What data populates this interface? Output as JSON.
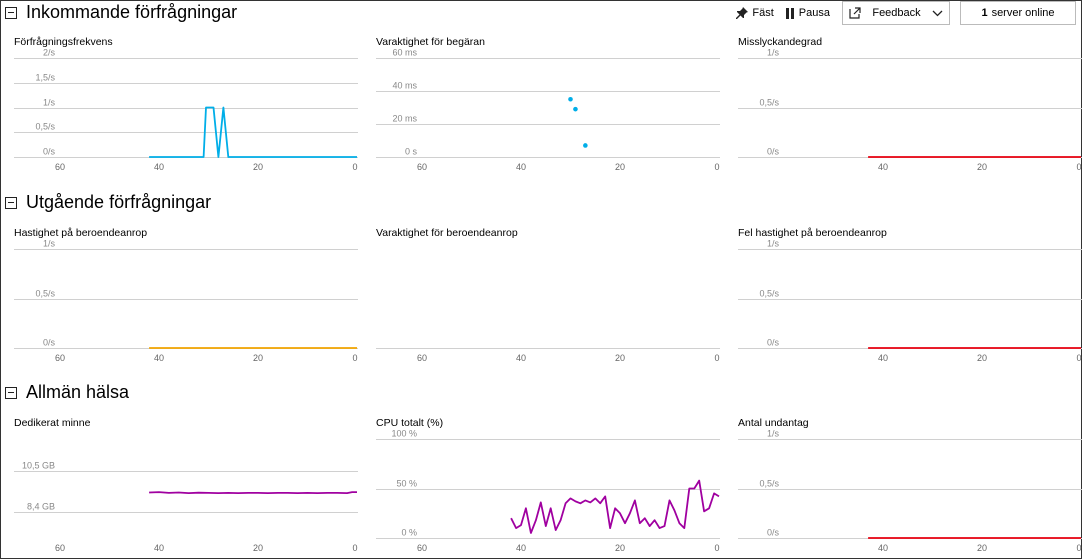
{
  "toolbar": {
    "pin_label": "Fäst",
    "pause_label": "Pausa",
    "feedback_label": "Feedback",
    "server_count": "1",
    "server_label": "server online"
  },
  "sections": [
    {
      "title": "Inkommande förfrågningar"
    },
    {
      "title": "Utgående förfrågningar"
    },
    {
      "title": "Allmän hälsa"
    }
  ],
  "colors": {
    "requests": "#00aee8",
    "failed": "#e8000f",
    "dependency": "#f2a500",
    "health": "#a000a0",
    "grid": "#d0d0d0"
  },
  "chart_data": [
    {
      "type": "line",
      "title": "Förfrågningsfrekvens",
      "yticks": [
        "2/s",
        "1,5/s",
        "1/s",
        "0,5/s",
        "0/s"
      ],
      "ylim": [
        0,
        2
      ],
      "xticks": [
        "60",
        "40",
        "20",
        "0"
      ],
      "xlim": [
        60,
        0
      ],
      "color": "#00aee8",
      "series": [
        {
          "x": [
            42,
            31,
            30.5,
            29,
            28,
            27,
            26,
            0
          ],
          "y": [
            0,
            0,
            1,
            1,
            0,
            1,
            0,
            0
          ]
        }
      ]
    },
    {
      "type": "scatter",
      "title": "Varaktighet för begäran",
      "yticks": [
        "60 ms",
        "40 ms",
        "20 ms",
        "0 s"
      ],
      "ylim": [
        0,
        60
      ],
      "xticks": [
        "60",
        "40",
        "20",
        "0"
      ],
      "xlim": [
        60,
        0
      ],
      "color": "#00aee8",
      "series": [
        {
          "x": [
            30,
            29,
            27
          ],
          "y": [
            35,
            29,
            7
          ]
        }
      ]
    },
    {
      "type": "line",
      "title": "Misslyckandegrad",
      "yticks": [
        "1/s",
        "0,5/s",
        "0/s"
      ],
      "ylim": [
        0,
        1
      ],
      "xticks": [
        "40",
        "20",
        "0"
      ],
      "xlim": [
        60,
        0
      ],
      "color": "#e8000f",
      "series": [
        {
          "x": [
            43,
            0
          ],
          "y": [
            0,
            0
          ]
        }
      ]
    },
    {
      "type": "line",
      "title": "Hastighet på beroendeanrop",
      "yticks": [
        "1/s",
        "0,5/s",
        "0/s"
      ],
      "ylim": [
        0,
        1
      ],
      "xticks": [
        "60",
        "40",
        "20",
        "0"
      ],
      "xlim": [
        60,
        0
      ],
      "color": "#f2a500",
      "series": [
        {
          "x": [
            42,
            0
          ],
          "y": [
            0,
            0
          ]
        }
      ]
    },
    {
      "type": "line",
      "title": "Varaktighet för beroendeanrop",
      "yticks": [],
      "ylim": [
        0,
        1
      ],
      "xticks": [
        "60",
        "40",
        "20",
        "0"
      ],
      "xlim": [
        60,
        0
      ],
      "color": "#00aee8",
      "series": []
    },
    {
      "type": "line",
      "title": "Fel hastighet på beroendeanrop",
      "yticks": [
        "1/s",
        "0,5/s",
        "0/s"
      ],
      "ylim": [
        0,
        1
      ],
      "xticks": [
        "40",
        "20",
        "0"
      ],
      "xlim": [
        60,
        0
      ],
      "color": "#e8000f",
      "series": [
        {
          "x": [
            43,
            0
          ],
          "y": [
            0,
            0
          ]
        }
      ]
    },
    {
      "type": "line",
      "title": "Dedikerat minne",
      "yticks": [
        "10,5 GB",
        "8,4 GB"
      ],
      "ytickvals": [
        10.5,
        8.4
      ],
      "ylim": [
        7.1,
        12.1
      ],
      "xticks": [
        "60",
        "40",
        "20",
        "0"
      ],
      "xlim": [
        60,
        0
      ],
      "color": "#a000a0",
      "series": [
        {
          "x": [
            42,
            40,
            38,
            36,
            34,
            32,
            30,
            28,
            26,
            24,
            22,
            20,
            18,
            16,
            14,
            12,
            10,
            8,
            6,
            4,
            2,
            1,
            0
          ],
          "y": [
            9.4,
            9.42,
            9.38,
            9.4,
            9.37,
            9.39,
            9.38,
            9.37,
            9.38,
            9.37,
            9.38,
            9.38,
            9.37,
            9.38,
            9.38,
            9.37,
            9.38,
            9.37,
            9.38,
            9.38,
            9.37,
            9.42,
            9.42
          ]
        }
      ]
    },
    {
      "type": "line",
      "title": "CPU totalt (%)",
      "yticks": [
        "100 %",
        "50 %",
        "0 %"
      ],
      "ylim": [
        0,
        100
      ],
      "xticks": [
        "60",
        "40",
        "20",
        "0"
      ],
      "xlim": [
        60,
        0
      ],
      "color": "#a000a0",
      "series": [
        {
          "x": [
            42,
            41,
            40,
            39,
            38,
            37,
            36,
            35,
            34,
            33,
            32,
            31,
            30,
            29,
            28,
            27,
            26,
            25,
            24,
            23,
            22,
            21,
            20,
            19,
            18,
            17,
            16,
            15,
            14,
            13,
            12,
            11,
            10,
            9,
            8,
            7,
            6,
            5,
            4,
            3,
            2,
            1,
            0
          ],
          "y": [
            20,
            10,
            13,
            30,
            5,
            18,
            36,
            12,
            30,
            8,
            18,
            35,
            40,
            37,
            35,
            38,
            36,
            40,
            35,
            42,
            10,
            30,
            25,
            15,
            25,
            38,
            15,
            20,
            12,
            18,
            10,
            12,
            38,
            28,
            15,
            10,
            50,
            50,
            58,
            27,
            30,
            45,
            42
          ]
        }
      ]
    },
    {
      "type": "line",
      "title": "Antal undantag",
      "yticks": [
        "1/s",
        "0,5/s",
        "0/s"
      ],
      "ylim": [
        0,
        1
      ],
      "xticks": [
        "40",
        "20",
        "0"
      ],
      "xlim": [
        60,
        0
      ],
      "color": "#e8000f",
      "series": [
        {
          "x": [
            43,
            0
          ],
          "y": [
            0,
            0
          ]
        }
      ]
    }
  ]
}
